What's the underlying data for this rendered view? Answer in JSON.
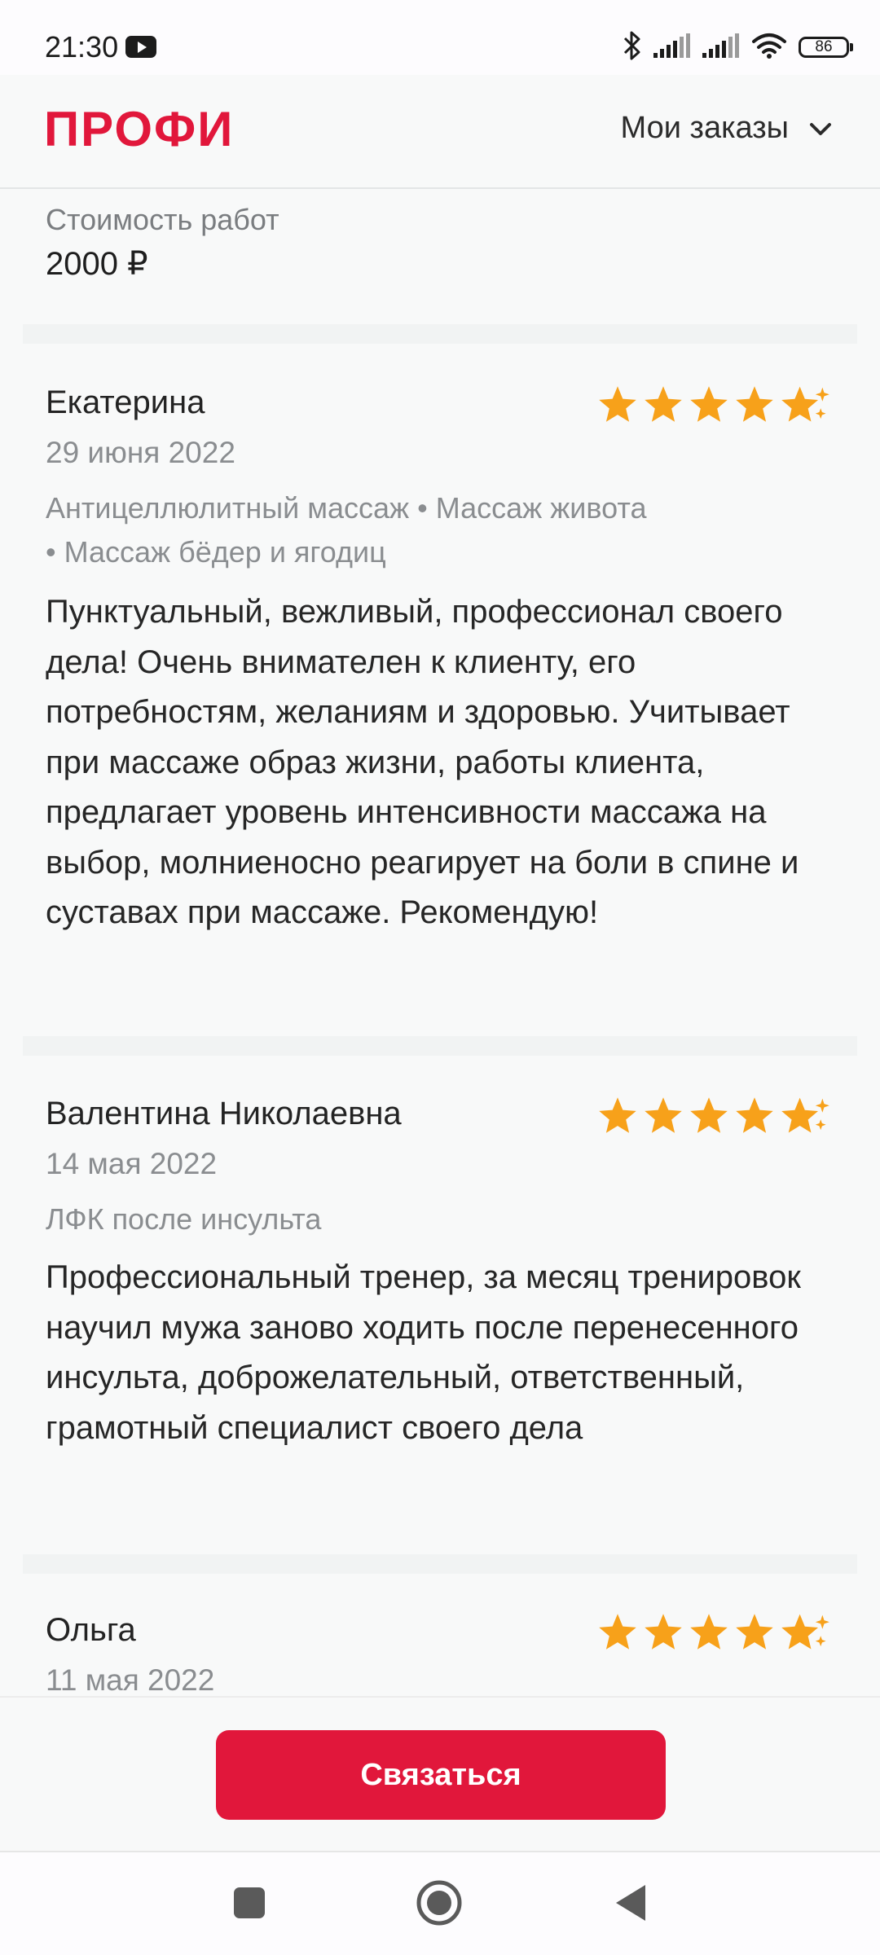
{
  "status_bar": {
    "time": "21:30",
    "battery": "86",
    "icons": [
      "youtube-icon",
      "bluetooth-icon",
      "signal-icon",
      "signal-icon",
      "wifi-icon",
      "battery-icon"
    ]
  },
  "header": {
    "logo": "ПРОФИ",
    "menu_label": "Мои заказы",
    "menu_icon": "chevron-down-icon"
  },
  "cost": {
    "label": "Стоимость работ",
    "value": "2000 ₽"
  },
  "reviews": [
    {
      "name": "Екатерина",
      "date": "29 июня 2022",
      "services_line1": "Антицеллюлитный массаж • Массаж живота",
      "services_line2": " • Массаж бёдер и ягодиц",
      "text": "Пунктуальный, вежливый, профессионал своего дела! Очень внимателен к клиенту, его потребностям, желаниям и здоровью. Учитывает при массаже образ жизни, работы клиента, предлагает уровень интенсивности массажа на выбор, молниеносно реагирует на боли в спине и суставах при массаже. Рекомендую!",
      "rating": 5
    },
    {
      "name": "Валентина Николаевна",
      "date": "14 мая 2022",
      "services_line1": "ЛФК после инсульта",
      "text": "Профессиональный тренер, за месяц тренировок научил мужа заново ходить после перенесенного инсульта, доброжелательный, ответственный, грамотный специалист своего дела",
      "rating": 5
    },
    {
      "name": "Ольга",
      "date": "11 мая 2022",
      "rating": 5
    }
  ],
  "contact_button": {
    "label": "Связаться"
  },
  "colors": {
    "brand": "#e1173b",
    "star": "#f7a11a",
    "background": "#f8f9f9"
  },
  "system_nav": {
    "icons": [
      "recents-icon",
      "home-icon",
      "back-icon"
    ]
  }
}
